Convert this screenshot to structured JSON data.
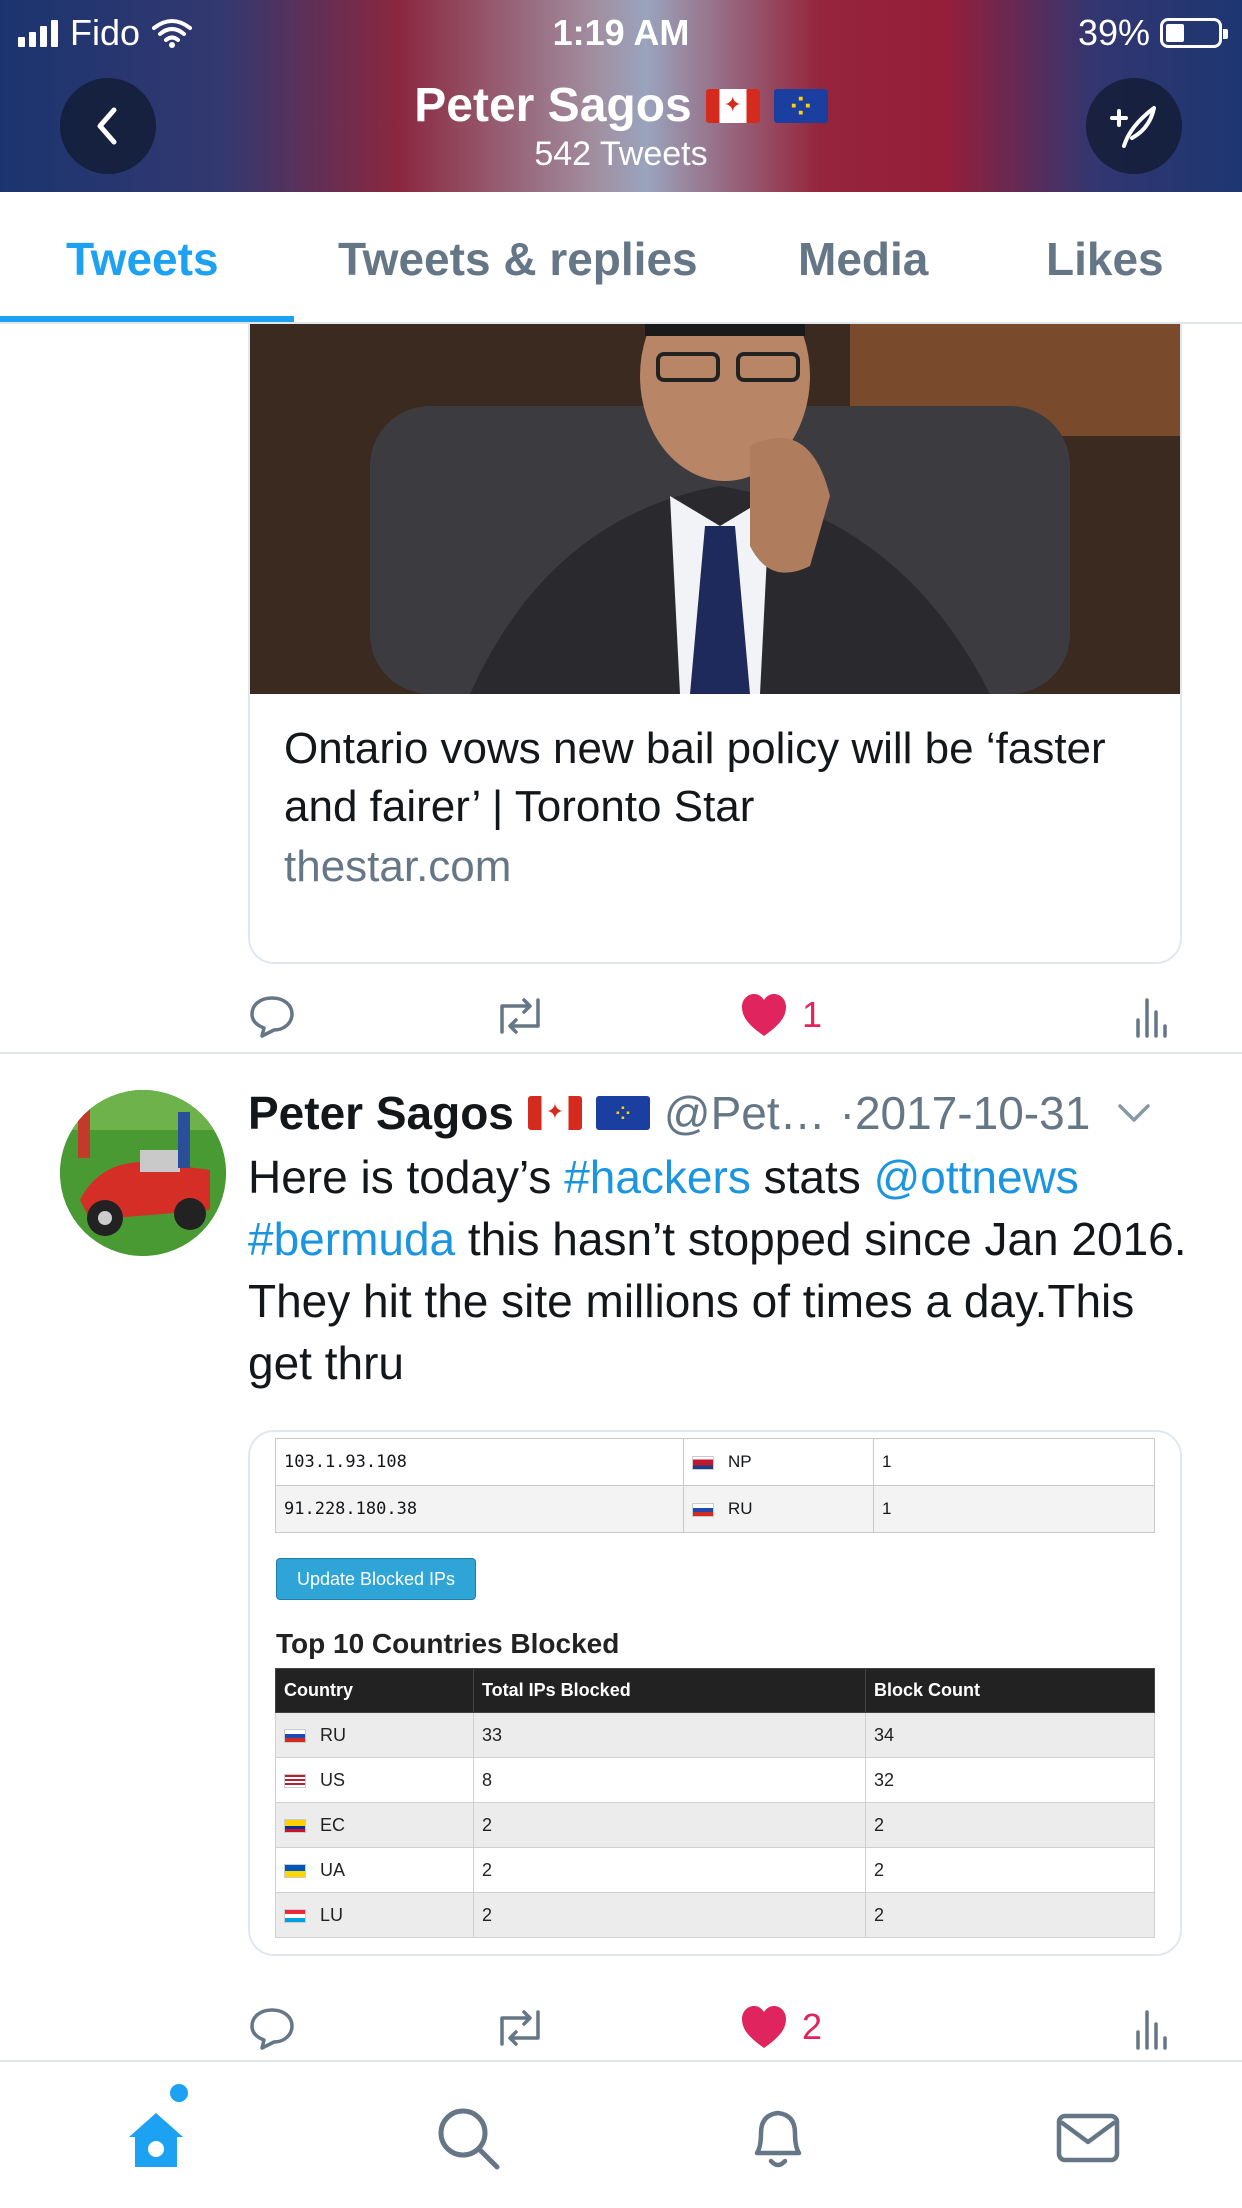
{
  "status_bar": {
    "carrier": "Fido",
    "time": "1:19 AM",
    "battery": "39%"
  },
  "header": {
    "name": "Peter Sagos",
    "tweet_count": "542 Tweets"
  },
  "tabs": [
    {
      "label": "Tweets",
      "active": true
    },
    {
      "label": "Tweets & replies",
      "active": false
    },
    {
      "label": "Media",
      "active": false
    },
    {
      "label": "Likes",
      "active": false
    }
  ],
  "tweet1": {
    "card_title": "Ontario vows new bail policy will be ‘faster and fairer’ | Toronto Star",
    "card_domain": "thestar.com",
    "like_count": "1"
  },
  "tweet2": {
    "name": "Peter Sagos",
    "handle": "@Pet…",
    "date": "·2017-10-31",
    "text_parts": {
      "p1": "Here is today’s ",
      "hashtag1": "#hackers",
      "p2": " stats ",
      "mention": "@ottnews",
      "hashtag2": "#bermuda",
      "p3": " this hasn’t stopped since Jan 2016. They hit the site millions of times a day.This get thru"
    },
    "image": {
      "ip_rows": [
        {
          "ip": "103.1.93.108",
          "country": "NP",
          "count": "1"
        },
        {
          "ip": "91.228.180.38",
          "country": "RU",
          "count": "1"
        }
      ],
      "update_button": "Update Blocked IPs",
      "table_title": "Top 10 Countries Blocked",
      "columns": [
        "Country",
        "Total IPs Blocked",
        "Block Count"
      ],
      "rows": [
        {
          "country": "RU",
          "ips": "33",
          "count": "34"
        },
        {
          "country": "US",
          "ips": "8",
          "count": "32"
        },
        {
          "country": "EC",
          "ips": "2",
          "count": "2"
        },
        {
          "country": "UA",
          "ips": "2",
          "count": "2"
        },
        {
          "country": "LU",
          "ips": "2",
          "count": "2"
        }
      ]
    },
    "like_count": "2"
  },
  "colors": {
    "accent": "#1da1f2",
    "link": "#1b95e0",
    "like": "#e0245e",
    "muted": "#657786"
  }
}
